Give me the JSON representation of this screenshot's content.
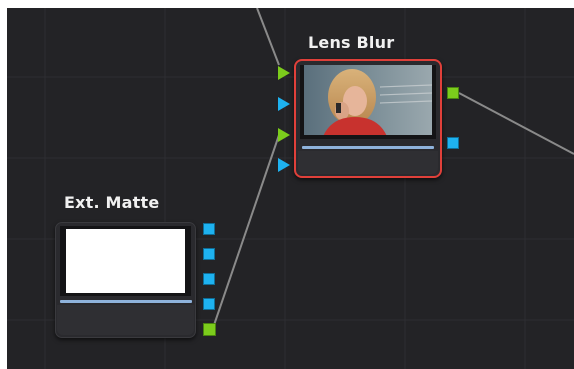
{
  "nodes": {
    "lens_blur": {
      "title": "Lens Blur",
      "selected": true,
      "selection_color": "#e0403a",
      "thumbnail": "photo of woman with blonde hair on phone",
      "inputs": [
        {
          "shape": "triangle",
          "color": "#7ccc1c"
        },
        {
          "shape": "triangle",
          "color": "#1eb2f0"
        },
        {
          "shape": "triangle",
          "color": "#7ccc1c"
        },
        {
          "shape": "triangle",
          "color": "#1eb2f0"
        }
      ],
      "outputs": [
        {
          "shape": "square",
          "color": "#7ccc1c"
        },
        {
          "shape": "square",
          "color": "#1eb2f0"
        }
      ]
    },
    "ext_matte": {
      "title": "Ext. Matte",
      "selected": false,
      "thumbnail": "white matte",
      "outputs": [
        {
          "shape": "square",
          "color": "#1eb2f0"
        },
        {
          "shape": "square",
          "color": "#1eb2f0"
        },
        {
          "shape": "square",
          "color": "#1eb2f0"
        },
        {
          "shape": "square",
          "color": "#1eb2f0"
        },
        {
          "shape": "square",
          "color": "#7ccc1c"
        }
      ]
    }
  },
  "colors": {
    "canvas_bg": "#232326",
    "grid_line": "#2f2f33",
    "wire": "#8a8a8a",
    "port_green": "#7ccc1c",
    "port_blue": "#1eb2f0"
  }
}
